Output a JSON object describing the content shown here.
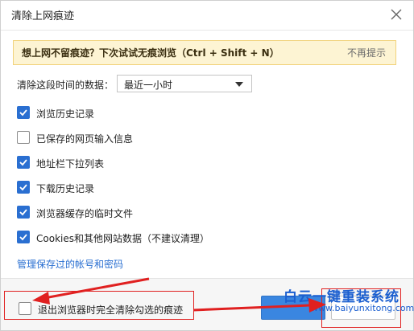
{
  "dialog": {
    "title": "清除上网痕迹"
  },
  "banner": {
    "text": "想上网不留痕迹？下次试试无痕浏览（Ctrl + Shift + N）",
    "dismiss_label": "不再提示"
  },
  "range": {
    "label": "清除这段时间的数据：",
    "selected": "最近一小时"
  },
  "options": [
    {
      "label": "浏览历史记录",
      "checked": true
    },
    {
      "label": "已保存的网页输入信息",
      "checked": false
    },
    {
      "label": "地址栏下拉列表",
      "checked": true
    },
    {
      "label": "下载历史记录",
      "checked": true
    },
    {
      "label": "浏览器缓存的临时文件",
      "checked": true
    },
    {
      "label": "Cookies和其他网站数据（不建议清理）",
      "checked": true
    }
  ],
  "manage_link": "管理保存过的帐号和密码",
  "footer": {
    "exit_clear_label": "退出浏览器时完全清除勾选的痕迹",
    "exit_clear_checked": false
  },
  "watermark": {
    "text": "白云一键重装系统",
    "url": "www.baiyunxitong.com"
  },
  "colors": {
    "accent": "#2a6fd1",
    "banner_bg": "#fdf4d3",
    "annotation": "#e02020"
  }
}
